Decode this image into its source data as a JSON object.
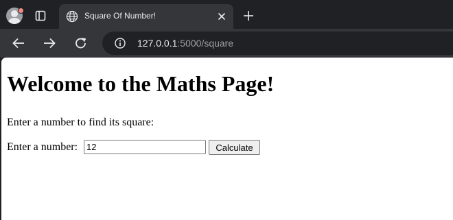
{
  "browser": {
    "tab": {
      "title": "Square Of Number!"
    },
    "address_bar": {
      "host": "127.0.0.1",
      "path": ":5000/square"
    },
    "colors": {
      "frame": "#202124",
      "toolbar": "#35363a",
      "omnibox": "#202124",
      "text": "#e8eaed",
      "muted_text": "#9aa0a6",
      "profile_badge": "#f28b82"
    },
    "icons": [
      "profile-avatar-icon",
      "tab-actions-icon",
      "globe-icon",
      "close-icon",
      "plus-icon",
      "back-arrow-icon",
      "forward-arrow-icon",
      "reload-icon",
      "site-info-icon"
    ]
  },
  "page": {
    "heading": "Welcome to the Maths Page!",
    "intro": "Enter a number to find its square:",
    "form": {
      "label": "Enter a number:",
      "input_value": "12",
      "button_label": "Calculate"
    }
  }
}
